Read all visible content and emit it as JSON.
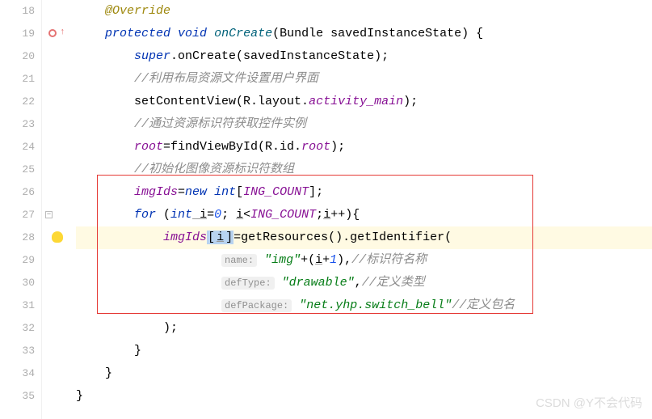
{
  "lineNumbers": [
    "18",
    "19",
    "20",
    "21",
    "22",
    "23",
    "24",
    "25",
    "26",
    "27",
    "28",
    "29",
    "30",
    "31",
    "32",
    "33",
    "34",
    "35"
  ],
  "code": {
    "l18": {
      "annotation": "@Override"
    },
    "l19": {
      "kw1": "protected",
      "kw2": "void",
      "method": "onCreate",
      "params": "(Bundle savedInstanceState) {"
    },
    "l20": {
      "kw": "super",
      "call": ".onCreate(savedInstanceState);"
    },
    "l21": {
      "comment": "//利用布局资源文件设置用户界面"
    },
    "l22": {
      "call": "setContentView(R.layout.",
      "field": "activity_main",
      "end": ");"
    },
    "l23": {
      "comment": "//通过资源标识符获取控件实例"
    },
    "l24": {
      "field1": "root",
      "mid": "=findViewById(R.id.",
      "field2": "root",
      "end": ");"
    },
    "l25": {
      "comment": "//初始化图像资源标识符数组"
    },
    "l26": {
      "field": "imgIds",
      "eq": "=",
      "kw1": "new",
      "sp": " ",
      "kw2": "int",
      "br1": "[",
      "const": "ING_COUNT",
      "br2": "];"
    },
    "l27": {
      "kw": "for",
      "open": " (",
      "kw2": "int",
      "var": " i",
      "eq": "=",
      "num": "0",
      "semi": "; ",
      "cond_i": "i",
      "lt": "<",
      "const": "ING_COUNT",
      "semi2": ";",
      "inc_i": "i",
      "incop": "++){"
    },
    "l28": {
      "field": "imgIds",
      "br1": "[",
      "var": "i",
      "br2": "]",
      "eq": "=getResources().getIdentifier("
    },
    "l29": {
      "hint": "name:",
      "str": "\"img\"",
      "plus": "+(",
      "var": "i",
      "plus2": "+",
      "num": "1",
      "close": "),",
      "comment": "//标识符名称"
    },
    "l30": {
      "hint": "defType:",
      "str": "\"drawable\"",
      "comma": ",",
      "comment": "//定义类型"
    },
    "l31": {
      "hint": "defPackage:",
      "str": "\"net.yhp.switch_bell\"",
      "comment": "//定义包名"
    },
    "l32": {
      "close": ");"
    },
    "l33": {
      "close": "}"
    },
    "l34": {
      "close": "}"
    },
    "l35": {
      "close": "}"
    }
  },
  "watermark": "CSDN @Y不会代码"
}
